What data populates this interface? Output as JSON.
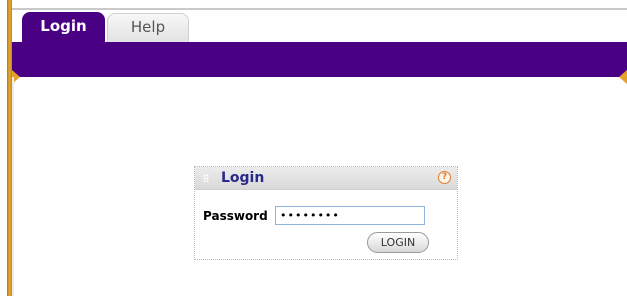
{
  "tabs": [
    {
      "label": "Login",
      "active": true
    },
    {
      "label": "Help",
      "active": false
    }
  ],
  "login_panel": {
    "title": "Login",
    "password_label": "Password",
    "password_value": "••••••••",
    "button_label": "LOGIN",
    "help_icon_glyph": "?"
  },
  "colors": {
    "brand_purple": "#4a0083",
    "accent_orange": "#e4a22c",
    "title_blue": "#2a2a8a"
  },
  "icons": [
    "grip-icon",
    "help-icon"
  ]
}
